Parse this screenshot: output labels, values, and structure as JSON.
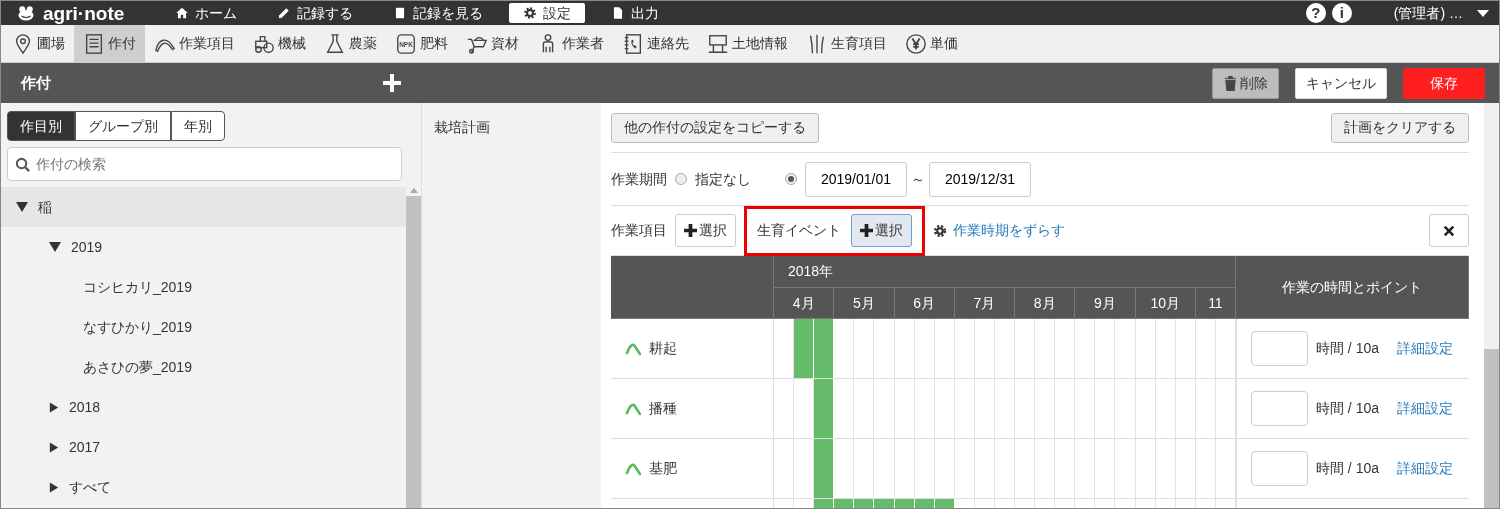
{
  "app": {
    "logo": "agri·note"
  },
  "main_nav": [
    {
      "label": "ホーム",
      "selected": false
    },
    {
      "label": "記録する",
      "selected": false
    },
    {
      "label": "記録を見る",
      "selected": false
    },
    {
      "label": "設定",
      "selected": true
    },
    {
      "label": "出力",
      "selected": false
    }
  ],
  "utility_icons": [
    "?",
    "i"
  ],
  "user": "(管理者) …",
  "settings_nav": [
    {
      "label": "圃場",
      "selected": false
    },
    {
      "label": "作付",
      "selected": true
    },
    {
      "label": "作業項目",
      "selected": false
    },
    {
      "label": "機械",
      "selected": false
    },
    {
      "label": "農薬",
      "selected": false
    },
    {
      "label": "肥料",
      "badge": "NPK",
      "selected": false
    },
    {
      "label": "資材",
      "selected": false
    },
    {
      "label": "作業者",
      "selected": false
    },
    {
      "label": "連絡先",
      "selected": false
    },
    {
      "label": "土地情報",
      "selected": false
    },
    {
      "label": "生育項目",
      "selected": false
    },
    {
      "label": "単価",
      "selected": false
    }
  ],
  "page_header": {
    "title": "作付",
    "buttons": [
      {
        "label": "削除",
        "kind": "delete"
      },
      {
        "label": "キャンセル",
        "kind": "cancel"
      },
      {
        "label": "保存",
        "kind": "save"
      }
    ]
  },
  "filter_tabs": [
    {
      "label": "作目別",
      "selected": true
    },
    {
      "label": "グループ別",
      "selected": false
    },
    {
      "label": "年別",
      "selected": false
    }
  ],
  "search": {
    "placeholder": "作付の検索"
  },
  "tree": [
    {
      "label": "稲",
      "expanded": true,
      "selected": true,
      "children": [
        {
          "label": "2019",
          "expanded": true,
          "selected": false,
          "children": [
            {
              "label": "コシヒカリ_2019",
              "selected": false
            },
            {
              "label": "なすひかり_2019",
              "selected": false
            },
            {
              "label": "あさひの夢_2019",
              "selected": false
            }
          ]
        },
        {
          "label": "2018",
          "expanded": false,
          "selected": false
        },
        {
          "label": "2017",
          "expanded": false,
          "selected": false
        },
        {
          "label": "すべて",
          "expanded": false,
          "selected": false
        }
      ]
    }
  ],
  "section_label": "栽培計画",
  "plan": {
    "copy_button": "他の作付の設定をコピーする",
    "clear_button": "計画をクリアする",
    "period": {
      "label": "作業期間",
      "options": [
        {
          "label": "指定なし",
          "selected": false
        },
        {
          "selected": true
        }
      ],
      "start": "2019/01/01",
      "separator": "～",
      "end": "2019/12/31"
    },
    "work_items": {
      "label": "作業項目",
      "button": "選択"
    },
    "growth_event": {
      "label": "生育イベント",
      "button": "選択",
      "highlighted": true,
      "button_active": true
    },
    "shift_link": "作業時期をずらす"
  },
  "timeline": {
    "year": "2018年",
    "months": [
      "4月",
      "5月",
      "6月",
      "7月",
      "8月",
      "9月",
      "10月",
      "11"
    ],
    "points_header": "作業の時間とポイント",
    "rows": [
      {
        "name": "耕起",
        "schedule": [
          false,
          true,
          true,
          false,
          false,
          false,
          false,
          false,
          false,
          false,
          false,
          false,
          false,
          false,
          false,
          false,
          false,
          false,
          false,
          false,
          false,
          false,
          false
        ],
        "unit": "時間 / 10a",
        "detail_link": "詳細設定"
      },
      {
        "name": "播種",
        "schedule": [
          false,
          false,
          true,
          false,
          false,
          false,
          false,
          false,
          false,
          false,
          false,
          false,
          false,
          false,
          false,
          false,
          false,
          false,
          false,
          false,
          false,
          false,
          false
        ],
        "unit": "時間 / 10a",
        "detail_link": "詳細設定"
      },
      {
        "name": "基肥",
        "schedule": [
          false,
          false,
          true,
          false,
          false,
          false,
          false,
          false,
          false,
          false,
          false,
          false,
          false,
          false,
          false,
          false,
          false,
          false,
          false,
          false,
          false,
          false,
          false
        ],
        "unit": "時間 / 10a",
        "detail_link": "詳細設定"
      },
      {
        "schedule": [
          false,
          false,
          true,
          true,
          true,
          true,
          true,
          true,
          true,
          false,
          false,
          false,
          false,
          false,
          false,
          false,
          false,
          false,
          false,
          false,
          false,
          false,
          false
        ]
      }
    ]
  }
}
